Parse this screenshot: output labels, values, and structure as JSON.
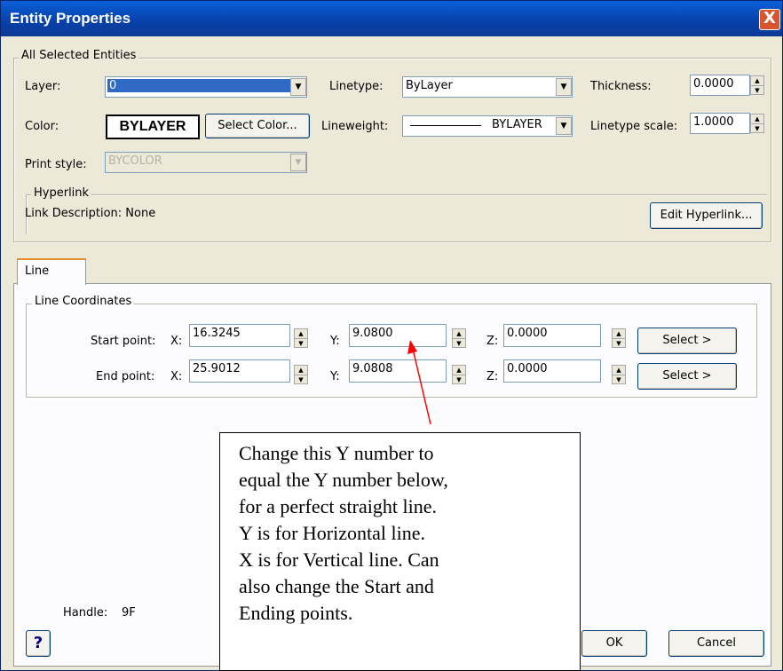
{
  "window": {
    "title": "Entity Properties",
    "close_label": "X"
  },
  "all_selected": {
    "group_label": "All Selected Entities",
    "layer_label": "Layer:",
    "layer_value": "0",
    "linetype_label": "Linetype:",
    "linetype_value": "ByLayer",
    "thickness_label": "Thickness:",
    "thickness_value": "0.0000",
    "color_label": "Color:",
    "color_value": "BYLAYER",
    "select_color_button": "Select Color...",
    "lineweight_label": "Lineweight:",
    "lineweight_value": "BYLAYER",
    "linetype_scale_label": "Linetype scale:",
    "linetype_scale_value": "1.0000",
    "print_style_label": "Print style:",
    "print_style_value": "BYCOLOR"
  },
  "hyperlink": {
    "group_label": "Hyperlink",
    "description": "Link Description: None",
    "edit_button": "Edit Hyperlink..."
  },
  "tabs": [
    {
      "label": "Line"
    }
  ],
  "line_coordinates": {
    "group_label": "Line Coordinates",
    "start": {
      "label": "Start point:",
      "x_label": "X:",
      "x": "16.3245",
      "y_label": "Y:",
      "y": "9.0800",
      "z_label": "Z:",
      "z": "0.0000",
      "select_button": "Select >"
    },
    "end": {
      "label": "End point:",
      "x_label": "X:",
      "x": "25.9012",
      "y_label": "Y:",
      "y": "9.0808",
      "z_label": "Z:",
      "z": "0.0000",
      "select_button": "Select >"
    }
  },
  "handle": {
    "label": "Handle:",
    "value": "9F"
  },
  "footer": {
    "help_label": "?",
    "ok_button": "OK",
    "cancel_button": "Cancel"
  },
  "annotation": {
    "lines": [
      "Change this Y number to",
      "equal the Y number below,",
      "for a perfect straight line.",
      "Y is for Horizontal line.",
      "X is for Vertical line. Can",
      "also change the Start and",
      "Ending points."
    ],
    "arrow_color": "#ff0000"
  },
  "colors": {
    "titlebar": "#0a5fd8",
    "layer_highlight": "#316ac5",
    "tab_accent": "#e68b2c"
  }
}
